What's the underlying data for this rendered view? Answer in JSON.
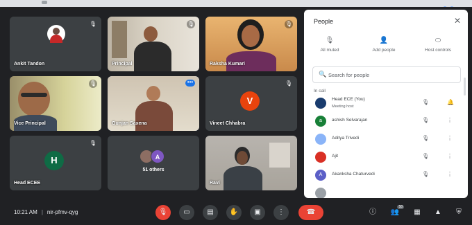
{
  "meet": {
    "tiles": [
      {
        "name": "Ankit Tandon"
      },
      {
        "name": "Principal"
      },
      {
        "name": "Raksha Kumari"
      },
      {
        "name": "Vice Principal"
      },
      {
        "name": "Gunjan Saxena"
      },
      {
        "name": "Vineet Chhabra",
        "initial": "V"
      },
      {
        "name": "Head ECEE",
        "initial": "H"
      },
      {
        "name": "51 others",
        "initial": "A"
      },
      {
        "name": "Ravi"
      }
    ]
  },
  "bottom": {
    "time": "10:21 AM",
    "meeting_code": "nir-pfmv-qyg",
    "participants_count": "58"
  },
  "people_panel": {
    "title": "People",
    "actions": [
      {
        "label": "All muted",
        "icon": "mic-off-icon"
      },
      {
        "label": "Add people",
        "icon": "add-person-icon"
      },
      {
        "label": "Host controls",
        "icon": "toggle-icon"
      }
    ],
    "search_placeholder": "Search for people",
    "section_label": "In call",
    "people": [
      {
        "name": "Head ECE (You)",
        "sub": "Meeting host",
        "color": "#1a3c6e",
        "initial": ""
      },
      {
        "name": "ashish Selvarajan",
        "color": "#188038",
        "initial": "a"
      },
      {
        "name": "Aditya Trivedi",
        "color": "#8ab4f8",
        "initial": ""
      },
      {
        "name": "Ajit",
        "color": "#d93025",
        "initial": ""
      },
      {
        "name": "Akanksha Chaturvedi",
        "color": "#5b5fc7",
        "initial": "A"
      },
      {
        "name": "",
        "color": "#9aa0a6",
        "initial": ""
      }
    ]
  },
  "colors": {
    "accent": "#8ab4f8",
    "hangup": "#ea4335",
    "avatar_v": "#e8430d",
    "avatar_h": "#0f6b45",
    "avatar_a": "#7e57c2"
  }
}
